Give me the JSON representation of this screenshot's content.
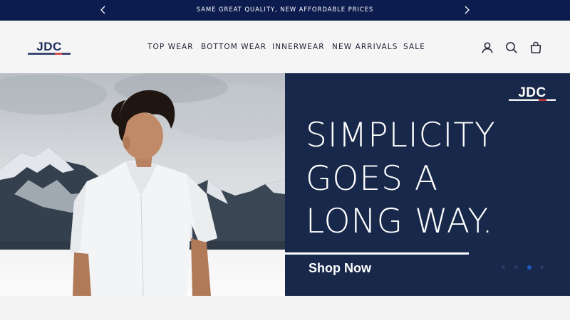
{
  "announcement": {
    "text": "SAME GREAT QUALITY, NEW AFFORDABLE PRICES",
    "prev_icon": "chevron-left-icon",
    "next_icon": "chevron-right-icon"
  },
  "header": {
    "logo_text": "JDC",
    "nav": [
      "TOP WEAR",
      "BOTTOM WEAR",
      "INNERWEAR",
      "NEW ARRIVALS",
      "SALE"
    ],
    "icons": [
      "account-icon",
      "search-icon",
      "cart-icon"
    ]
  },
  "hero": {
    "headline": [
      "SIMPLICITY",
      "GOES A",
      "LONG WAY."
    ],
    "cta": "Shop Now",
    "logo_text": "JDC",
    "slides_total": 4,
    "slide_active": 3
  },
  "colors": {
    "announcement_bg": "#0c1c4e",
    "hero_panel_bg": "#18284a",
    "brand_navy": "#1c2c5c",
    "brand_red": "#d6312f",
    "header_bg": "#f5f5f5"
  }
}
